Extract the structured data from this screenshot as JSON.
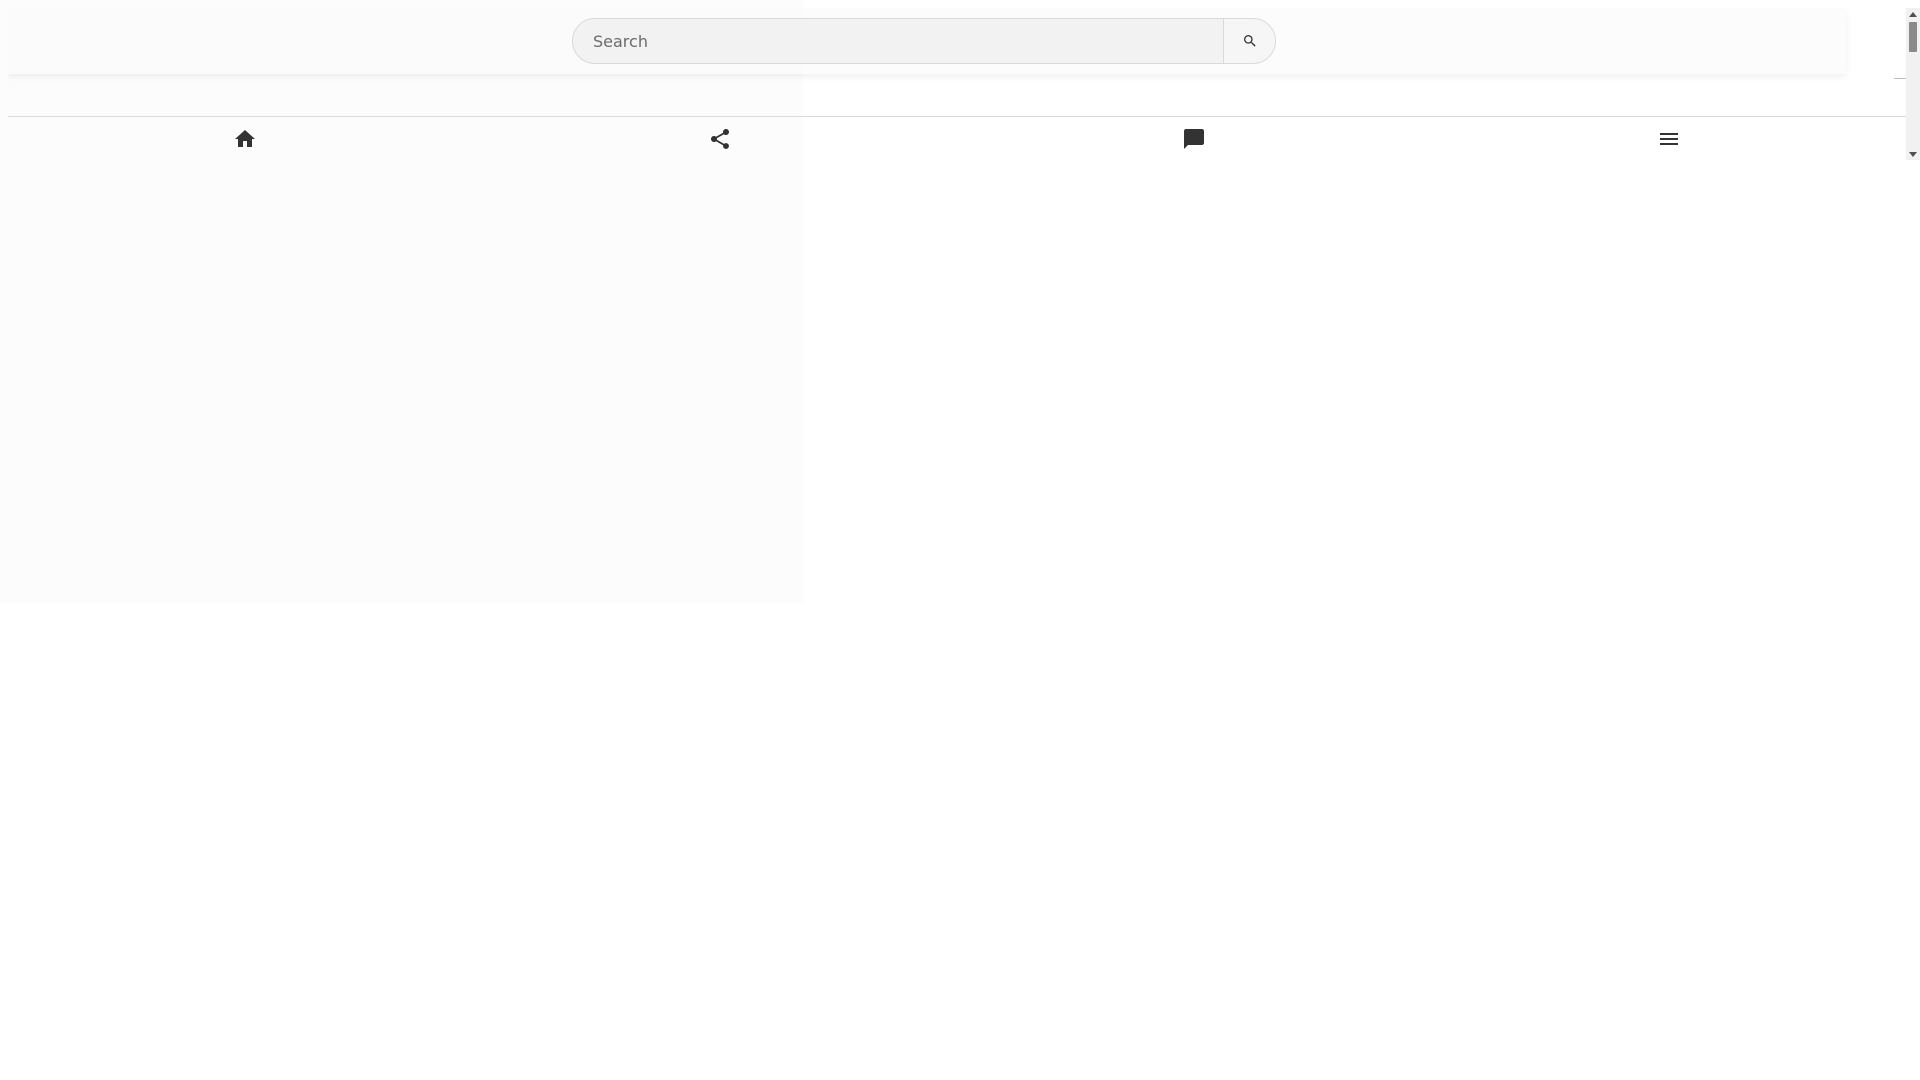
{
  "search": {
    "placeholder": "Search",
    "value": "",
    "button_icon": "search-icon"
  },
  "bottom_nav": {
    "items": [
      {
        "icon": "home-icon"
      },
      {
        "icon": "share-icon"
      },
      {
        "icon": "chat-icon"
      },
      {
        "icon": "menu-icon"
      }
    ]
  },
  "colors": {
    "icon": "#333333",
    "search_bg": "#f2f2f2",
    "border": "#d9d9d9",
    "scroll_thumb": "#8a8a8a"
  }
}
